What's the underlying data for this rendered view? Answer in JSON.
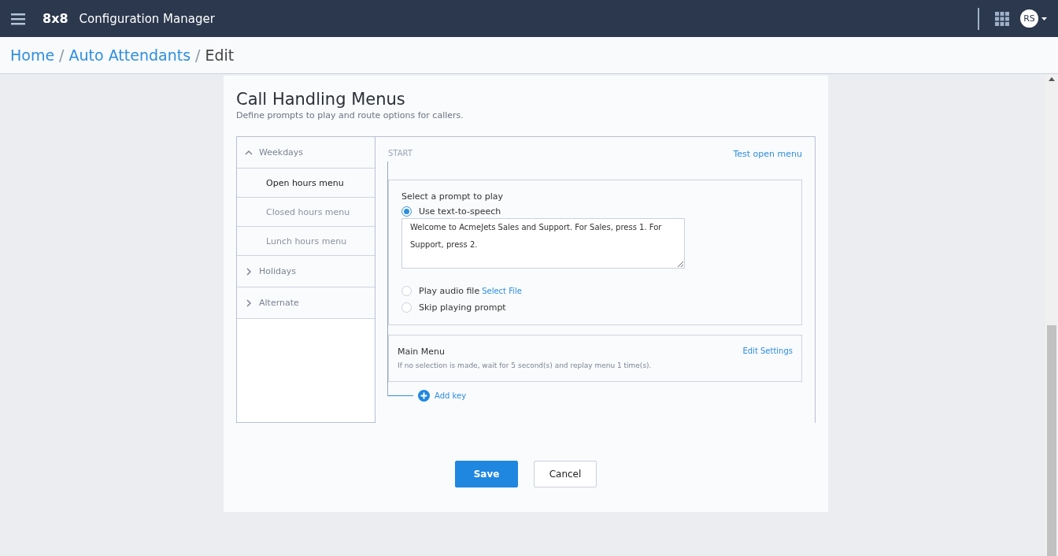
{
  "header": {
    "brand": "8x8",
    "title": "Configuration Manager",
    "avatar": "RS"
  },
  "breadcrumb_separator": "/",
  "breadcrumb": [
    {
      "label": "Home",
      "kind": "link"
    },
    {
      "label": "Auto Attendants",
      "kind": "link"
    },
    {
      "label": "Edit",
      "kind": "current"
    }
  ],
  "page": {
    "title": "Call Handling Menus",
    "subtitle": "Define prompts to play and route options for callers."
  },
  "sidebar": {
    "groups": [
      {
        "label": "Weekdays",
        "expanded": true,
        "children": [
          {
            "label": "Open hours menu",
            "selected": true
          },
          {
            "label": "Closed hours menu",
            "selected": false
          },
          {
            "label": "Lunch hours menu",
            "selected": false
          }
        ]
      },
      {
        "label": "Holidays",
        "expanded": false
      },
      {
        "label": "Alternate",
        "expanded": false
      }
    ]
  },
  "flow": {
    "start_label": "START",
    "test_link": "Test open menu",
    "prompt": {
      "heading": "Select a prompt to play",
      "tts_text": "Welcome to AcmeJets Sales and Support. For Sales, press 1. For Support, press 2.",
      "options": [
        {
          "label": "Use text-to-speech",
          "selected": true,
          "kind": "tts"
        },
        {
          "label": "Play audio file",
          "selected": false,
          "kind": "file",
          "link": "Select File"
        },
        {
          "label": "Skip playing prompt",
          "selected": false,
          "kind": "plain"
        }
      ]
    },
    "main_menu": {
      "title": "Main Menu",
      "edit_link": "Edit Settings",
      "description": "If no selection is made, wait for 5 second(s) and replay menu 1 time(s)."
    },
    "add_key": "Add key"
  },
  "buttons": [
    {
      "label": "Save",
      "kind": "primary"
    },
    {
      "label": "Cancel",
      "kind": "secondary"
    }
  ]
}
